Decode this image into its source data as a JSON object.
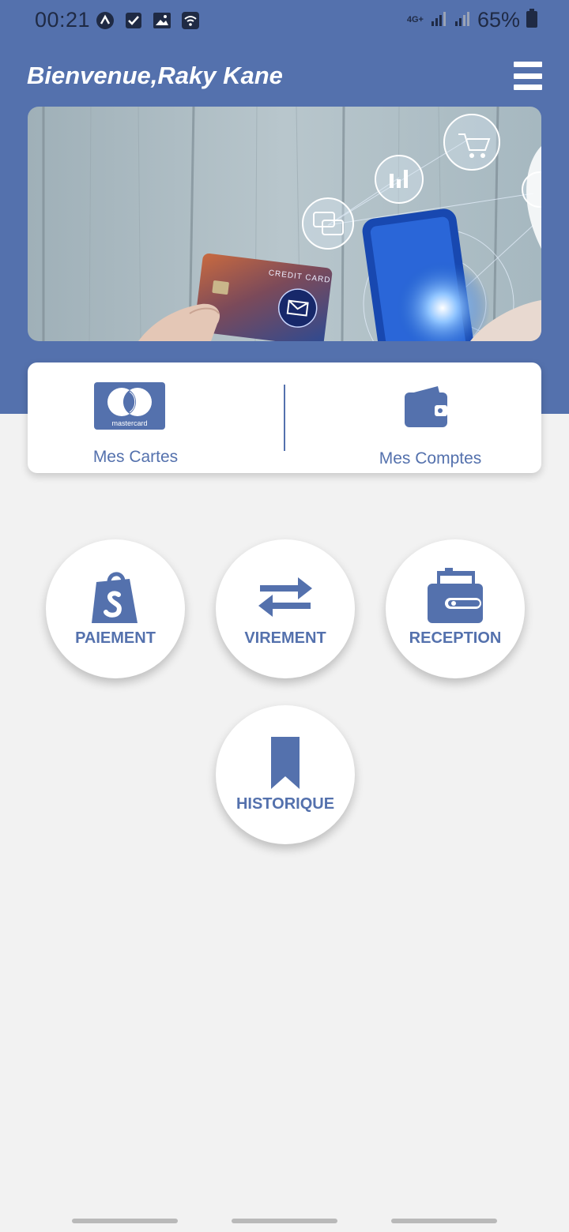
{
  "status_bar": {
    "time": "00:21",
    "network": "4G+",
    "battery": "65%"
  },
  "header": {
    "welcome": "Bienvenue,Raky Kane"
  },
  "banner": {
    "card_text": "CREDIT CARD"
  },
  "quick_access": {
    "cards_label": "Mes Cartes",
    "mastercard_text": "mastercard",
    "accounts_label": "Mes Comptes"
  },
  "actions": [
    {
      "label": "PAIEMENT",
      "icon": "shopping-bag-icon"
    },
    {
      "label": "VIREMENT",
      "icon": "transfer-arrows-icon"
    },
    {
      "label": "RECEPTION",
      "icon": "wallet-icon"
    },
    {
      "label": "HISTORIQUE",
      "icon": "bookmark-icon"
    }
  ],
  "colors": {
    "primary": "#5471ad",
    "background": "#f2f2f2",
    "surface": "#ffffff"
  }
}
